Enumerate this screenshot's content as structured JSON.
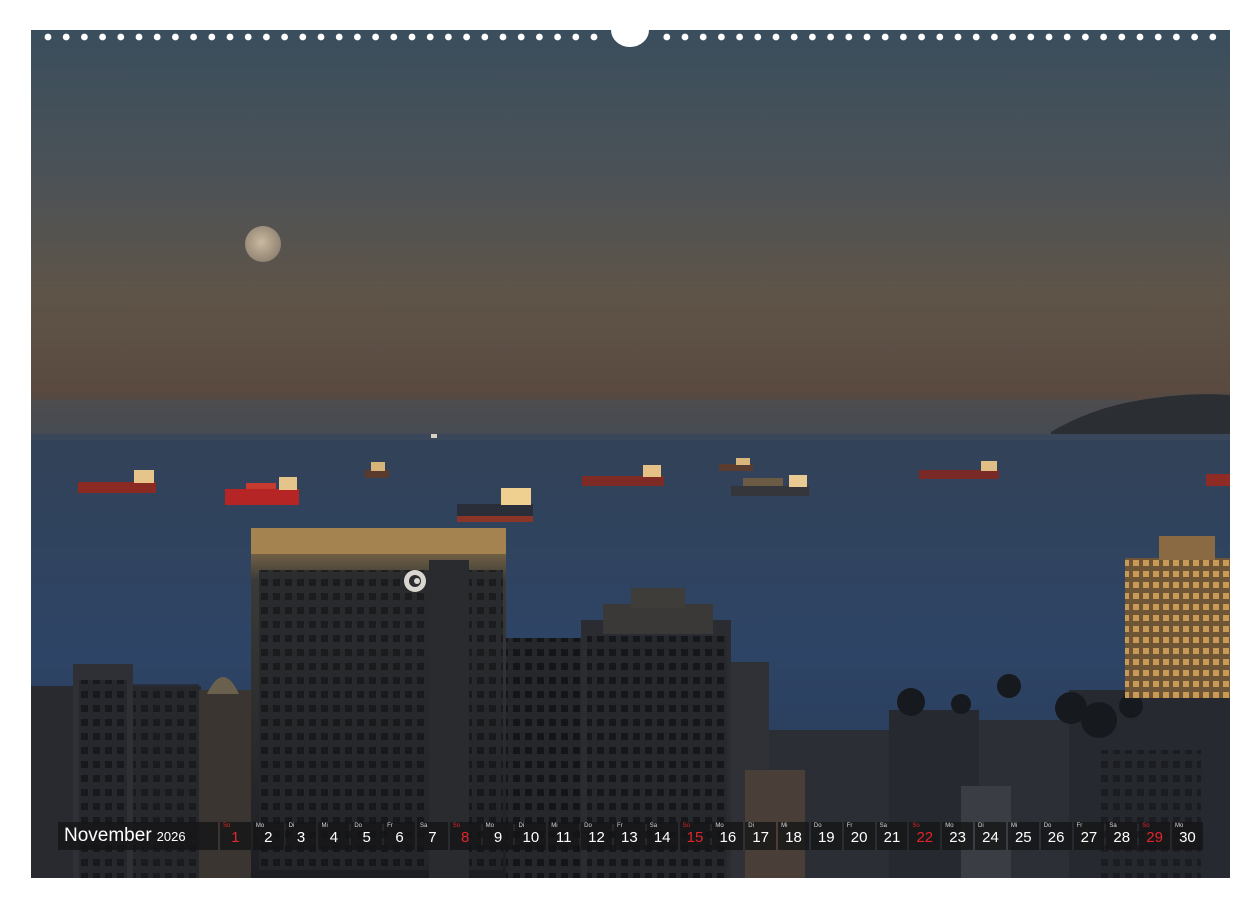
{
  "calendar": {
    "month": "November",
    "year": "2026",
    "accent_color": "#e0262a",
    "days": [
      {
        "dow": "So",
        "num": "1",
        "holiday": true
      },
      {
        "dow": "Mo",
        "num": "2",
        "holiday": false
      },
      {
        "dow": "Di",
        "num": "3",
        "holiday": false
      },
      {
        "dow": "Mi",
        "num": "4",
        "holiday": false
      },
      {
        "dow": "Do",
        "num": "5",
        "holiday": false
      },
      {
        "dow": "Fr",
        "num": "6",
        "holiday": false
      },
      {
        "dow": "Sa",
        "num": "7",
        "holiday": false
      },
      {
        "dow": "So",
        "num": "8",
        "holiday": true
      },
      {
        "dow": "Mo",
        "num": "9",
        "holiday": false
      },
      {
        "dow": "Di",
        "num": "10",
        "holiday": false
      },
      {
        "dow": "Mi",
        "num": "11",
        "holiday": false
      },
      {
        "dow": "Do",
        "num": "12",
        "holiday": false
      },
      {
        "dow": "Fr",
        "num": "13",
        "holiday": false
      },
      {
        "dow": "Sa",
        "num": "14",
        "holiday": false
      },
      {
        "dow": "So",
        "num": "15",
        "holiday": true
      },
      {
        "dow": "Mo",
        "num": "16",
        "holiday": false
      },
      {
        "dow": "Di",
        "num": "17",
        "holiday": false
      },
      {
        "dow": "Mi",
        "num": "18",
        "holiday": false
      },
      {
        "dow": "Do",
        "num": "19",
        "holiday": false
      },
      {
        "dow": "Fr",
        "num": "20",
        "holiday": false
      },
      {
        "dow": "Sa",
        "num": "21",
        "holiday": false
      },
      {
        "dow": "So",
        "num": "22",
        "holiday": true
      },
      {
        "dow": "Mo",
        "num": "23",
        "holiday": false
      },
      {
        "dow": "Di",
        "num": "24",
        "holiday": false
      },
      {
        "dow": "Mi",
        "num": "25",
        "holiday": false
      },
      {
        "dow": "Do",
        "num": "26",
        "holiday": false
      },
      {
        "dow": "Fr",
        "num": "27",
        "holiday": false
      },
      {
        "dow": "Sa",
        "num": "28",
        "holiday": false
      },
      {
        "dow": "So",
        "num": "29",
        "holiday": true
      },
      {
        "dow": "Mo",
        "num": "30",
        "holiday": false
      }
    ]
  }
}
